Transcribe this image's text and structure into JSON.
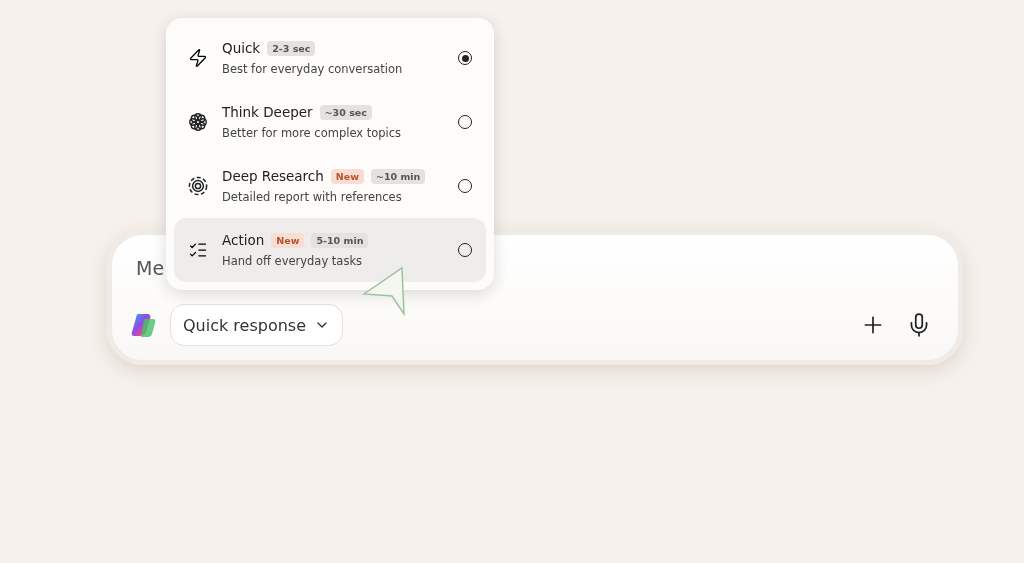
{
  "mode_menu": {
    "items": [
      {
        "kind": "quick",
        "title": "Quick",
        "badges": [
          {
            "kind": "time",
            "text": "2-3 sec"
          }
        ],
        "description": "Best for everyday conversation",
        "selected": true,
        "hovered": false
      },
      {
        "kind": "think",
        "title": "Think Deeper",
        "badges": [
          {
            "kind": "time",
            "text": "~30 sec"
          }
        ],
        "description": "Better for more complex topics",
        "selected": false,
        "hovered": false
      },
      {
        "kind": "research",
        "title": "Deep Research",
        "badges": [
          {
            "kind": "new",
            "text": "New"
          },
          {
            "kind": "time",
            "text": "~10 min"
          }
        ],
        "description": "Detailed report with references",
        "selected": false,
        "hovered": false
      },
      {
        "kind": "action",
        "title": "Action",
        "badges": [
          {
            "kind": "new",
            "text": "New"
          },
          {
            "kind": "time",
            "text": "5-10 min"
          }
        ],
        "description": "Hand off everyday tasks",
        "selected": false,
        "hovered": true
      }
    ]
  },
  "composer": {
    "placeholder": "Me",
    "mode_button": "Quick response"
  }
}
